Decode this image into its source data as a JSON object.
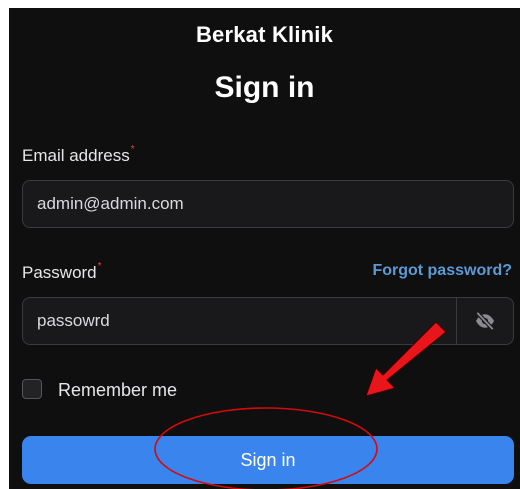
{
  "brand": "Berkat Klinik",
  "heading": "Sign in",
  "email": {
    "label": "Email address",
    "required_mark": "*",
    "value": "admin@admin.com"
  },
  "password": {
    "label": "Password",
    "required_mark": "*",
    "value": "passowrd",
    "forgot_link": "Forgot password?",
    "toggle_icon": "eye-slash-icon"
  },
  "remember": {
    "label": "Remember me",
    "checked": false
  },
  "submit_label": "Sign in",
  "colors": {
    "background": "#0f0f10",
    "accent": "#3a84ee",
    "link": "#5b9bd5",
    "required": "#e5484d",
    "annotation": "#e8161b"
  }
}
